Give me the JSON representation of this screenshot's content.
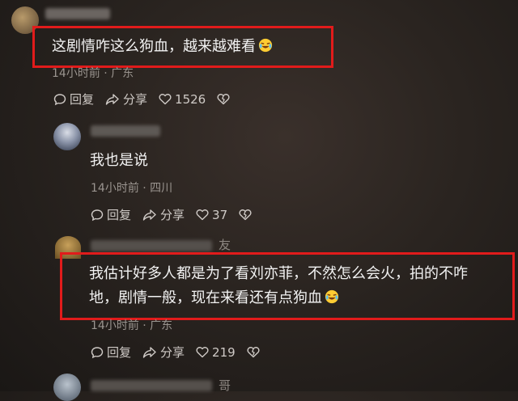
{
  "comments": [
    {
      "text": "这剧情咋这么狗血，越来越难看",
      "meta": "14小时前 · 广东",
      "reply_label": "回复",
      "share_label": "分享",
      "like_count": "1526"
    },
    {
      "text": "我也是说",
      "meta": "14小时前 · 四川",
      "reply_label": "回复",
      "share_label": "分享",
      "like_count": "37"
    },
    {
      "text_line1": "我估计好多人都是为了看刘亦菲，不然怎么会火，拍的不咋",
      "text_line2": "地，剧情一般，现在来看还有点狗血",
      "meta": "14小时前 · 广东",
      "reply_label": "回复",
      "share_label": "分享",
      "like_count": "219"
    }
  ],
  "partial_name_chars": [
    "友",
    "哥"
  ],
  "colors": {
    "highlight": "#e11b1b",
    "meta": "#9a948f",
    "text": "#f2f2f2"
  }
}
